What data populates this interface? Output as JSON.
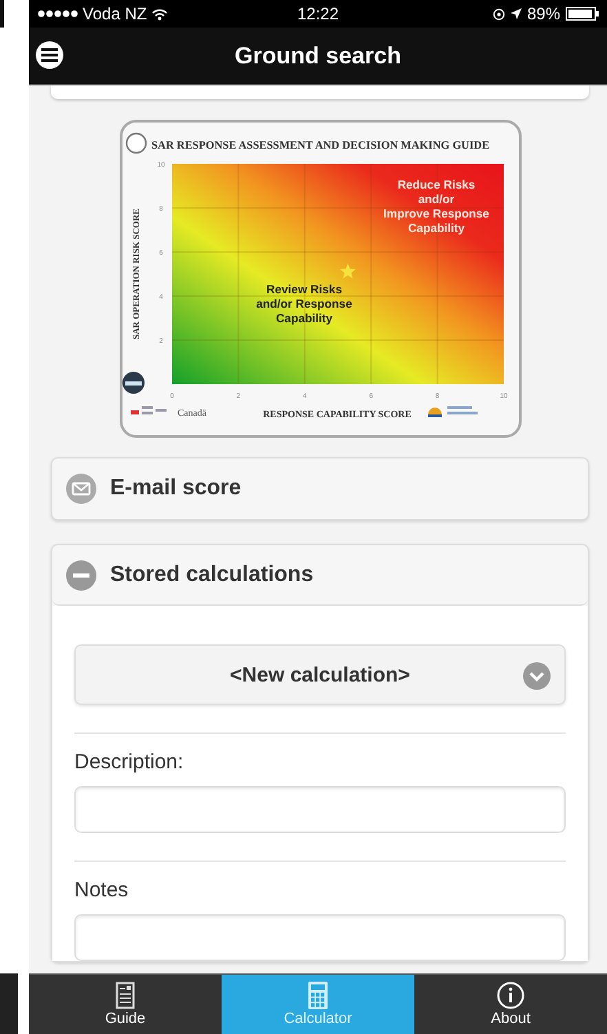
{
  "status_bar": {
    "carrier": "Voda NZ",
    "time": "12:22",
    "battery": "89%"
  },
  "header": {
    "title": "Ground search"
  },
  "guide_card": {
    "title": "SAR RESPONSE ASSESSMENT AND DECISION MAKING GUIDE",
    "logo_text": "Canadä",
    "zones": [
      {
        "lines": [
          "Reduce Risks",
          "and/or",
          "Improve Response",
          "Capability"
        ],
        "kind": "high"
      },
      {
        "lines": [
          "Review Risks",
          "and/or Response",
          "Capability"
        ],
        "kind": "medium"
      }
    ],
    "chart_data": {
      "type": "scatter",
      "grid": true,
      "xlabel": "RESPONSE CAPABILITY SCORE",
      "ylabel": "SAR OPERATION RISK SCORE",
      "xlim": [
        0,
        10
      ],
      "ylim": [
        0,
        10
      ],
      "xticks": [
        0,
        2,
        4,
        6,
        8,
        10
      ],
      "yticks": [
        2,
        4,
        6,
        8,
        10
      ],
      "x": [
        5.3
      ],
      "series": [
        {
          "color": "#f6e23c",
          "values": [
            5.1
          ]
        }
      ]
    }
  },
  "panels": [
    {
      "kind": "link",
      "label": "E-mail score",
      "expanded": false
    },
    {
      "kind": "collapsible",
      "label": "Stored calculations",
      "expanded": true
    }
  ],
  "stored": {
    "select": "<New calculation>",
    "fields": [
      {
        "label": "Description:"
      },
      {
        "label": "Notes"
      }
    ]
  },
  "tabs": [
    {
      "kind": "guide",
      "label": "Guide",
      "selected": false
    },
    {
      "kind": "calculator",
      "label": "Calculator",
      "selected": true
    },
    {
      "kind": "about",
      "label": "About",
      "selected": false
    }
  ]
}
